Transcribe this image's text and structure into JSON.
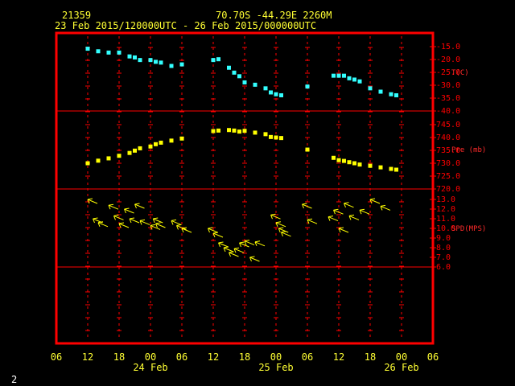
{
  "header": {
    "station": "21359",
    "location": "70.70S   -44.29E   2260M",
    "period": "23 Feb 2015/120000UTC - 26 Feb 2015/000000UTC"
  },
  "footer": {
    "page_number": "2"
  },
  "colors": {
    "frame": "#ff0000",
    "text_yellow": "#ffff33",
    "temp": "#33ffff",
    "pressure": "#ffff00",
    "wind": "#ffff00",
    "background": "#000000"
  },
  "chart_data": [
    {
      "type": "scatter",
      "panel": "temperature",
      "ylabel": "T(C)",
      "ylim": [
        -40,
        -12
      ],
      "yticks": [
        -15,
        -20,
        -25,
        -30,
        -35,
        -40
      ],
      "x": [
        "2015-02-23T12:00",
        "2015-02-23T14:00",
        "2015-02-23T16:00",
        "2015-02-23T18:00",
        "2015-02-23T20:00",
        "2015-02-23T21:00",
        "2015-02-23T22:00",
        "2015-02-24T00:00",
        "2015-02-24T01:00",
        "2015-02-24T02:00",
        "2015-02-24T04:00",
        "2015-02-24T06:00",
        "2015-02-24T12:00",
        "2015-02-24T13:00",
        "2015-02-24T15:00",
        "2015-02-24T16:00",
        "2015-02-24T17:00",
        "2015-02-24T18:00",
        "2015-02-24T20:00",
        "2015-02-24T22:00",
        "2015-02-24T23:00",
        "2015-02-25T00:00",
        "2015-02-25T01:00",
        "2015-02-25T06:00",
        "2015-02-25T11:00",
        "2015-02-25T12:00",
        "2015-02-25T13:00",
        "2015-02-25T14:00",
        "2015-02-25T15:00",
        "2015-02-25T16:00",
        "2015-02-25T18:00",
        "2015-02-25T20:00",
        "2015-02-25T22:00",
        "2015-02-25T23:00"
      ],
      "y": [
        -15.8,
        -16.8,
        -17.3,
        -17.3,
        -18.8,
        -19.2,
        -20.2,
        -20.2,
        -20.9,
        -21.2,
        -22.5,
        -21.9,
        -20.2,
        -19.9,
        -23.2,
        -25.1,
        -26.5,
        -28.9,
        -29.8,
        -31.2,
        -32.8,
        -33.5,
        -33.9,
        -30.5,
        -26.3,
        -26.3,
        -26.3,
        -27.3,
        -27.8,
        -28.5,
        -31.2,
        -32.5,
        -33.5,
        -33.9
      ]
    },
    {
      "type": "scatter",
      "panel": "pressure",
      "ylabel": "Pre (mb)",
      "ylim": [
        720,
        748
      ],
      "yticks": [
        745,
        740,
        735,
        730,
        725,
        720
      ],
      "x": [
        "2015-02-23T12:00",
        "2015-02-23T14:00",
        "2015-02-23T16:00",
        "2015-02-23T18:00",
        "2015-02-23T20:00",
        "2015-02-23T21:00",
        "2015-02-23T22:00",
        "2015-02-24T00:00",
        "2015-02-24T01:00",
        "2015-02-24T02:00",
        "2015-02-24T04:00",
        "2015-02-24T06:00",
        "2015-02-24T12:00",
        "2015-02-24T13:00",
        "2015-02-24T15:00",
        "2015-02-24T16:00",
        "2015-02-24T17:00",
        "2015-02-24T18:00",
        "2015-02-24T20:00",
        "2015-02-24T22:00",
        "2015-02-24T23:00",
        "2015-02-25T00:00",
        "2015-02-25T01:00",
        "2015-02-25T06:00",
        "2015-02-25T11:00",
        "2015-02-25T12:00",
        "2015-02-25T13:00",
        "2015-02-25T14:00",
        "2015-02-25T15:00",
        "2015-02-25T16:00",
        "2015-02-25T18:00",
        "2015-02-25T20:00",
        "2015-02-25T22:00",
        "2015-02-25T23:00"
      ],
      "y": [
        730,
        731,
        731.9,
        732.9,
        734,
        734.9,
        735.8,
        736.5,
        737.4,
        738,
        738.8,
        739.6,
        742.5,
        742.7,
        742.9,
        742.7,
        742.3,
        742.6,
        741.9,
        741.3,
        740.2,
        740,
        739.8,
        735.3,
        732.1,
        731.2,
        730.9,
        730.4,
        730,
        729.5,
        729.0,
        728.4,
        727.8,
        727.5
      ]
    },
    {
      "type": "scatter",
      "panel": "wind",
      "ylabel": "SPD(MPS)",
      "ylim": [
        6,
        13
      ],
      "yticks": [
        13.0,
        12.0,
        11.0,
        10.0,
        9.0,
        8.0,
        7.0,
        6.0
      ],
      "x": [
        "2015-02-23T12:00",
        "2015-02-23T13:00",
        "2015-02-23T14:00",
        "2015-02-23T16:00",
        "2015-02-23T17:00",
        "2015-02-23T18:00",
        "2015-02-23T19:00",
        "2015-02-23T20:00",
        "2015-02-23T21:00",
        "2015-02-23T22:00",
        "2015-02-24T00:00",
        "2015-02-24T00:30",
        "2015-02-24T01:00",
        "2015-02-24T04:00",
        "2015-02-24T05:00",
        "2015-02-24T06:00",
        "2015-02-24T11:00",
        "2015-02-24T12:00",
        "2015-02-24T13:00",
        "2015-02-24T14:00",
        "2015-02-24T15:00",
        "2015-02-24T16:00",
        "2015-02-24T17:00",
        "2015-02-24T18:00",
        "2015-02-24T19:00",
        "2015-02-24T20:00",
        "2015-02-24T23:00",
        "2015-02-25T00:00",
        "2015-02-25T00:30",
        "2015-02-25T01:00",
        "2015-02-25T05:00",
        "2015-02-25T06:00",
        "2015-02-25T10:00",
        "2015-02-25T11:00",
        "2015-02-25T12:00",
        "2015-02-25T13:00",
        "2015-02-25T14:00",
        "2015-02-25T16:00",
        "2015-02-25T18:00",
        "2015-02-25T20:00"
      ],
      "y": [
        13.0,
        11.0,
        10.6,
        12.4,
        11.3,
        10.5,
        12.0,
        11.0,
        12.5,
        10.8,
        10.3,
        11.0,
        10.5,
        10.8,
        10.3,
        10.0,
        10.0,
        9.5,
        8.5,
        8.0,
        7.5,
        7.9,
        8.5,
        8.7,
        7.0,
        8.6,
        11.4,
        10.6,
        10.0,
        9.6,
        12.5,
        10.9,
        11.2,
        11.9,
        10.0,
        12.6,
        11.3,
        11.9,
        13.0,
        12.3
      ]
    }
  ],
  "x_axis": {
    "ticks": [
      "06",
      "12",
      "18",
      "00",
      "06",
      "12",
      "18",
      "00",
      "06",
      "12",
      "18",
      "00",
      "06"
    ],
    "dates": [
      "24 Feb",
      "25 Feb",
      "26 Feb"
    ]
  }
}
